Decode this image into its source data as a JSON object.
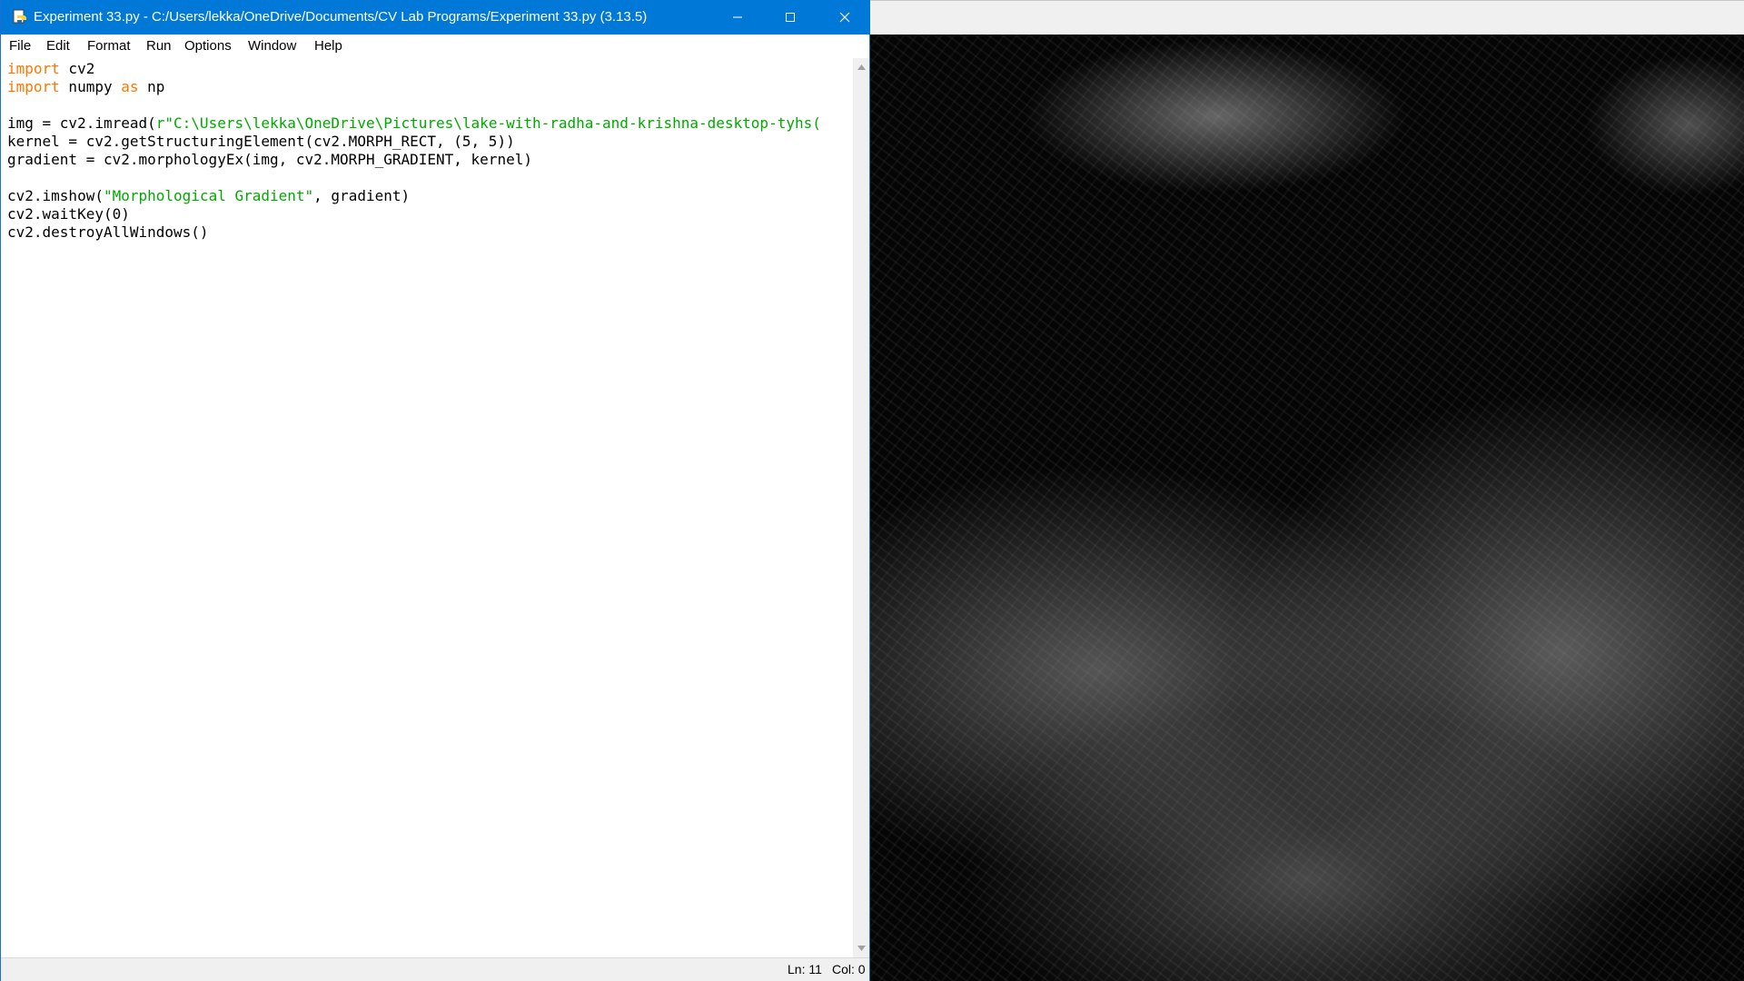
{
  "editor": {
    "title": "Experiment 33.py - C:/Users/lekka/OneDrive/Documents/CV Lab Programs/Experiment 33.py (3.13.5)",
    "menu": [
      "File",
      "Edit",
      "Format",
      "Run",
      "Options",
      "Window",
      "Help"
    ],
    "code": {
      "line1": {
        "kw": "import",
        "rest": " cv2"
      },
      "line2": {
        "kw1": "import",
        "mid": " numpy ",
        "kw2": "as",
        "rest": " np"
      },
      "line4": {
        "pre": "img = cv2.imread(",
        "str": "r\"C:\\Users\\lekka\\OneDrive\\Pictures\\lake-with-radha-and-krishna-desktop-tyhs("
      },
      "line5": "kernel = cv2.getStructuringElement(cv2.MORPH_RECT, (5, 5))",
      "line6": "gradient = cv2.morphologyEx(img, cv2.MORPH_GRADIENT, kernel)",
      "line8": {
        "pre": "cv2.imshow(",
        "str": "\"Morphological Gradient\"",
        "post": ", gradient)"
      },
      "line9": "cv2.waitKey(0)",
      "line10": "cv2.destroyAllWindows()"
    },
    "status": {
      "line": "Ln: 11",
      "col": "Col: 0"
    },
    "colors": {
      "titlebar": "#0078d7",
      "keyword": "#ff7700",
      "string": "#00aa00"
    }
  },
  "output_window": {
    "image_icon": "morphological-gradient-image"
  }
}
